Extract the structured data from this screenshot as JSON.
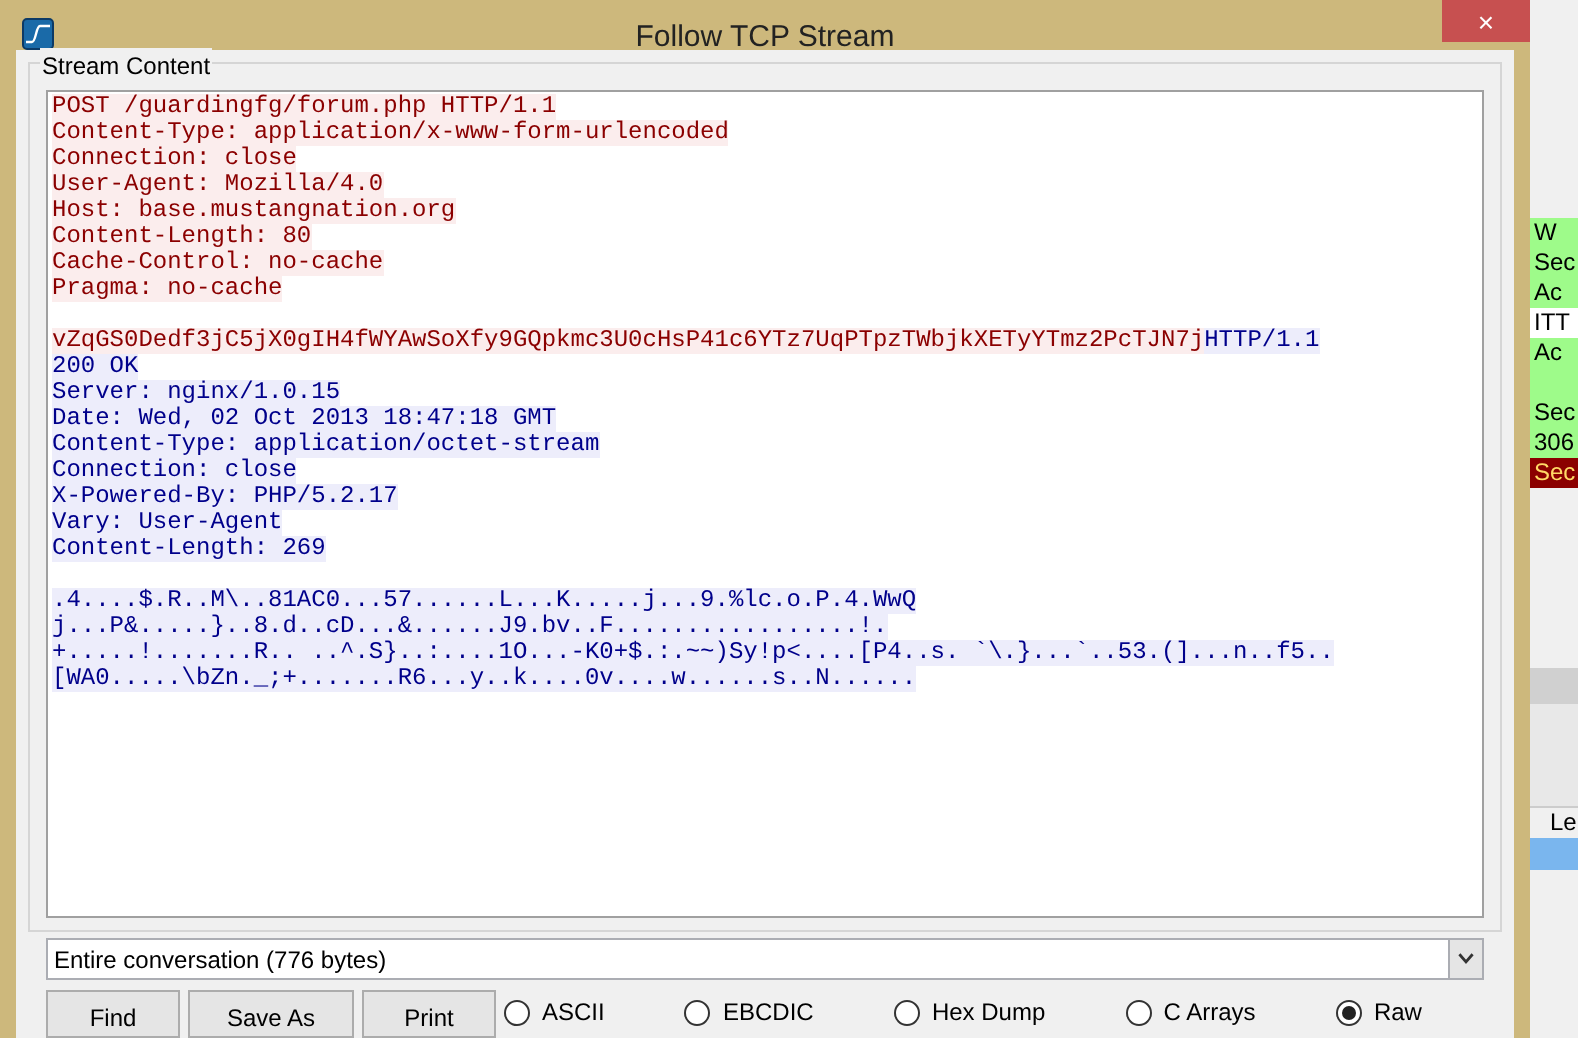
{
  "window": {
    "title": "Follow TCP Stream",
    "close": "×"
  },
  "group_label": "Stream Content",
  "paragraphs": [
    {
      "lines": [
        {
          "runs": [
            {
              "kind": "client",
              "text": "POST /guardingfg/forum.php HTTP/1.1"
            }
          ]
        },
        {
          "runs": [
            {
              "kind": "client",
              "text": "Content-Type: application/x-www-form-urlencoded"
            }
          ]
        },
        {
          "runs": [
            {
              "kind": "client",
              "text": "Connection: close"
            }
          ]
        },
        {
          "runs": [
            {
              "kind": "client",
              "text": "User-Agent: Mozilla/4.0"
            }
          ]
        },
        {
          "runs": [
            {
              "kind": "client",
              "text": "Host: base.mustangnation.org"
            }
          ]
        },
        {
          "runs": [
            {
              "kind": "client",
              "text": "Content-Length: 80"
            }
          ]
        },
        {
          "runs": [
            {
              "kind": "client",
              "text": "Cache-Control: no-cache"
            }
          ]
        },
        {
          "runs": [
            {
              "kind": "client",
              "text": "Pragma: no-cache"
            }
          ]
        }
      ]
    },
    {
      "lines": [
        {
          "runs": [
            {
              "kind": "client",
              "text": "vZqGS0Dedf3jC5jX0gIH4fWYAwSoXfy9GQpkmc3U0cHsP41c6YTz7UqPTpzTWbjkXETyYTmz2PcTJN7j"
            },
            {
              "kind": "server",
              "text": "HTTP/1.1"
            }
          ]
        },
        {
          "runs": [
            {
              "kind": "server",
              "text": "200 OK"
            }
          ]
        },
        {
          "runs": [
            {
              "kind": "server",
              "text": "Server: nginx/1.0.15"
            }
          ]
        },
        {
          "runs": [
            {
              "kind": "server",
              "text": "Date: Wed, 02 Oct 2013 18:47:18 GMT"
            }
          ]
        },
        {
          "runs": [
            {
              "kind": "server",
              "text": "Content-Type: application/octet-stream"
            }
          ]
        },
        {
          "runs": [
            {
              "kind": "server",
              "text": "Connection: close"
            }
          ]
        },
        {
          "runs": [
            {
              "kind": "server",
              "text": "X-Powered-By: PHP/5.2.17"
            }
          ]
        },
        {
          "runs": [
            {
              "kind": "server",
              "text": "Vary: User-Agent"
            }
          ]
        },
        {
          "runs": [
            {
              "kind": "server",
              "text": "Content-Length: 269"
            }
          ]
        }
      ]
    },
    {
      "lines": [
        {
          "runs": [
            {
              "kind": "server",
              "text": ".4....$.R..M\\..81AC0...57......L...K.....j...9.%lc.o.P.4.WwQ"
            }
          ]
        },
        {
          "runs": [
            {
              "kind": "server",
              "text": "j...P&.....}..8.d..cD...&......J9.bv..F.................!."
            }
          ]
        },
        {
          "runs": [
            {
              "kind": "server",
              "text": "+.....!.......R.. ..^.S}..:....1O...-K0+$.:.~~)Sy!p<....[P4..s. `\\.}...`..53.(]...n..f5.."
            }
          ]
        },
        {
          "runs": [
            {
              "kind": "server",
              "text": "[WA0.....\\bZn._;+.......R6...y..k....0v....w......s..N......"
            }
          ]
        }
      ]
    }
  ],
  "conversation_select": {
    "value": "Entire conversation (776 bytes)"
  },
  "buttons": [
    "Find",
    "Save As",
    "Print"
  ],
  "formats": [
    {
      "label": "ASCII",
      "selected": false
    },
    {
      "label": "EBCDIC",
      "selected": false
    },
    {
      "label": "Hex Dump",
      "selected": false
    },
    {
      "label": "C Arrays",
      "selected": false
    },
    {
      "label": "Raw",
      "selected": true
    }
  ],
  "background_rows": [
    {
      "text": "W",
      "color": "#9efb8a"
    },
    {
      "text": "Sec",
      "color": "#9efb8a"
    },
    {
      "text": "Ac",
      "color": "#9efb8a"
    },
    {
      "text": "ITT",
      "color": "#ffffff"
    },
    {
      "text": "Ac",
      "color": "#9efb8a"
    },
    {
      "color": "#9efb8a"
    },
    {
      "text": "Sec",
      "color": "#9efb8a"
    },
    {
      "text": "306",
      "color": "#9efb8a"
    },
    {
      "text": "Sec",
      "color": "#8b0000"
    }
  ],
  "background_detail_label": "Le"
}
